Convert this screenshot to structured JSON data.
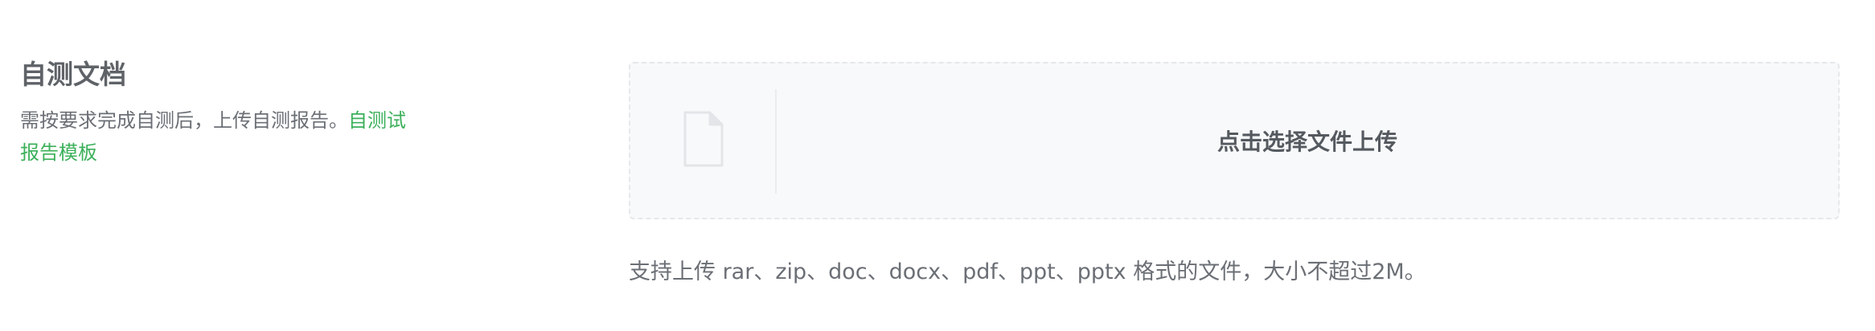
{
  "self_test": {
    "title": "自测文档",
    "description": "需按要求完成自测后，上传自测报告。",
    "template_link": "自测试报告模板"
  },
  "upload": {
    "icon": "file-icon",
    "label": "点击选择文件上传",
    "hint": "支持上传 rar、zip、doc、docx、pdf、ppt、pptx 格式的文件，大小不超过2M。"
  },
  "colors": {
    "link": "#3bb05a",
    "title": "#5f6368",
    "text": "#6b6f75",
    "upload_bg": "#f8f9fa",
    "upload_border": "#e6e8eb"
  }
}
